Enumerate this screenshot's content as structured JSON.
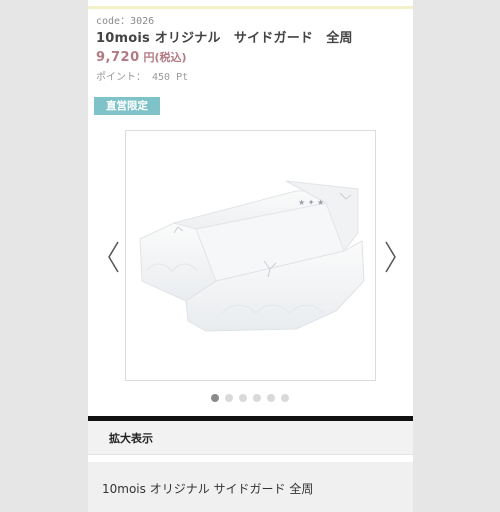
{
  "product": {
    "code": "code：3026",
    "title": "10mois オリジナル　サイドガード　全周",
    "price_value": "9,720",
    "price_suffix": "円(税込)",
    "points_label": "ポイント：",
    "points_value": "450 Pt",
    "badge": "直営限定"
  },
  "gallery": {
    "image_alt": "サイドガード",
    "slide_count": 6,
    "active_index": 0
  },
  "zoom": {
    "label": "拡大表示"
  },
  "product_name": "10mois オリジナル サイドガード 全周",
  "colors": {
    "badge": "#7fc2c8",
    "price": "#b27a83",
    "divider": "#111111"
  }
}
